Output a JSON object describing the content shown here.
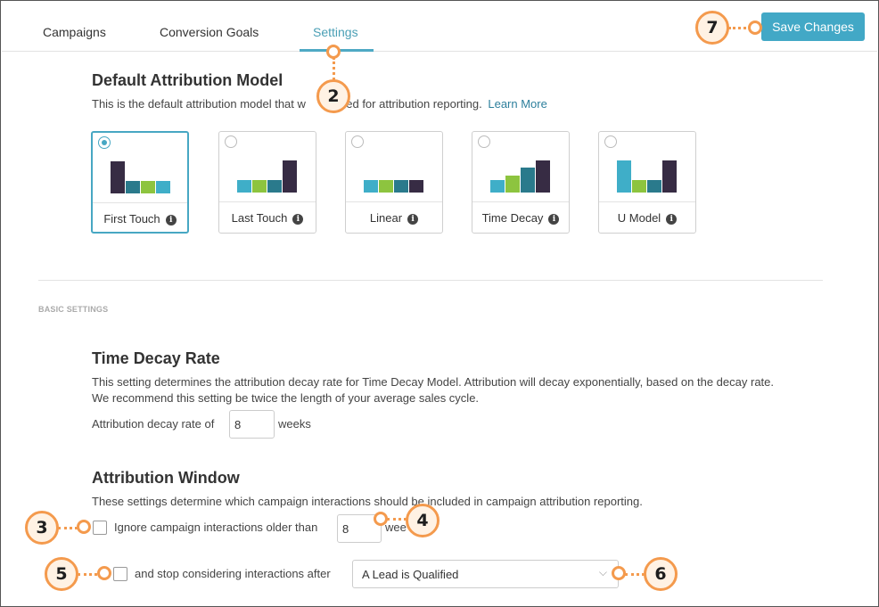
{
  "tabs": {
    "campaigns": "Campaigns",
    "conversion_goals": "Conversion Goals",
    "settings": "Settings"
  },
  "toolbar": {
    "save_label": "Save Changes"
  },
  "attribution_model": {
    "title": "Default Attribution Model",
    "desc_before": "This is the default attribution model that w",
    "desc_after": " used for attribution reporting.",
    "learn_more": "Learn More",
    "selected": "First Touch",
    "models": [
      {
        "label": "First Touch",
        "bars": [
          [
            "#372c44",
            36
          ],
          [
            "#2a7a8c",
            14
          ],
          [
            "#8dc43f",
            14
          ],
          [
            "#3faec8",
            14
          ]
        ]
      },
      {
        "label": "Last Touch",
        "bars": [
          [
            "#3faec8",
            14
          ],
          [
            "#8dc43f",
            14
          ],
          [
            "#2a7a8c",
            14
          ],
          [
            "#372c44",
            36
          ]
        ]
      },
      {
        "label": "Linear",
        "bars": [
          [
            "#3faec8",
            14
          ],
          [
            "#8dc43f",
            14
          ],
          [
            "#2a7a8c",
            14
          ],
          [
            "#372c44",
            14
          ]
        ]
      },
      {
        "label": "Time Decay",
        "bars": [
          [
            "#3faec8",
            14
          ],
          [
            "#8dc43f",
            19
          ],
          [
            "#2a7a8c",
            28
          ],
          [
            "#372c44",
            36
          ]
        ]
      },
      {
        "label": "U Model",
        "bars": [
          [
            "#3faec8",
            36
          ],
          [
            "#8dc43f",
            14
          ],
          [
            "#2a7a8c",
            14
          ],
          [
            "#372c44",
            36
          ]
        ]
      }
    ],
    "info_glyph": "i"
  },
  "basic_settings": {
    "label": "BASIC SETTINGS"
  },
  "time_decay": {
    "title": "Time Decay Rate",
    "desc_line1": "This setting determines the attribution decay rate for Time Decay Model. Attribution will decay exponentially, based on the decay rate.",
    "desc_line2": "We recommend this setting be twice the length of your average sales cycle.",
    "rate_prefix": "Attribution decay rate of",
    "rate_value": "8",
    "rate_suffix": "weeks"
  },
  "attribution_window": {
    "title": "Attribution Window",
    "desc": "These settings determine which campaign interactions should be included in campaign attribution reporting.",
    "ignore_label": "Ignore campaign interactions older than",
    "ignore_value": "8",
    "ignore_suffix": "wee",
    "stop_label": "and stop considering interactions after",
    "stop_selected": "A Lead is Qualified"
  },
  "callouts": {
    "c2": "2",
    "c3": "3",
    "c4": "4",
    "c5": "5",
    "c6": "6",
    "c7": "7"
  },
  "colors": {
    "accent": "#42a8c6",
    "callout_border": "#f49a4d",
    "callout_fill": "#fff2e4"
  }
}
